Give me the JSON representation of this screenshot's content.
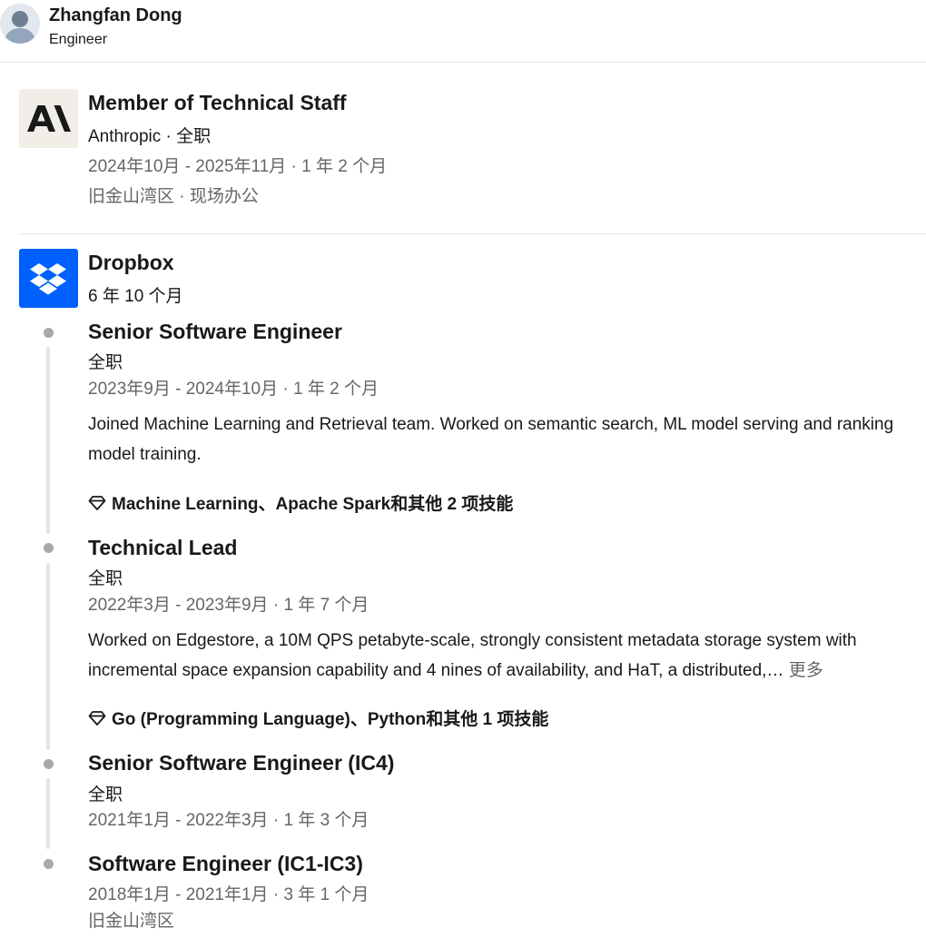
{
  "profile": {
    "name": "Zhangfan Dong",
    "headline": "Engineer"
  },
  "experiences": [
    {
      "logo_icon": "anthropic-logo",
      "title": "Member of Technical Staff",
      "company_line": "Anthropic · 全职",
      "dates": "2024年10月 - 2025年11月 · 1 年 2 个月",
      "location": "旧金山湾区 · 现场办公"
    },
    {
      "logo_icon": "dropbox-logo",
      "company": "Dropbox",
      "total_duration": "6 年 10 个月",
      "roles": [
        {
          "title": "Senior Software Engineer",
          "type": "全职",
          "dates": "2023年9月 - 2024年10月 · 1 年 2 个月",
          "description": "Joined Machine Learning and Retrieval team. Worked on semantic search, ML model serving and ranking model training.",
          "skills": "Machine Learning、Apache Spark和其他 2 项技能"
        },
        {
          "title": "Technical Lead",
          "type": "全职",
          "dates": "2022年3月 - 2023年9月 · 1 年 7 个月",
          "description": "Worked on Edgestore, a 10M QPS petabyte-scale, strongly consistent metadata storage system with incremental space expansion capability and 4 nines of availability, and HaT, a distributed,…",
          "see_more": "更多",
          "skills": "Go (Programming Language)、Python和其他 1 项技能"
        },
        {
          "title": "Senior Software Engineer (IC4)",
          "type": "全职",
          "dates": "2021年1月 - 2022年3月 · 1 年 3 个月"
        },
        {
          "title": "Software Engineer (IC1-IC3)",
          "dates": "2018年1月 - 2021年1月 · 3 年 1 个月",
          "location": "旧金山湾区"
        }
      ]
    }
  ]
}
